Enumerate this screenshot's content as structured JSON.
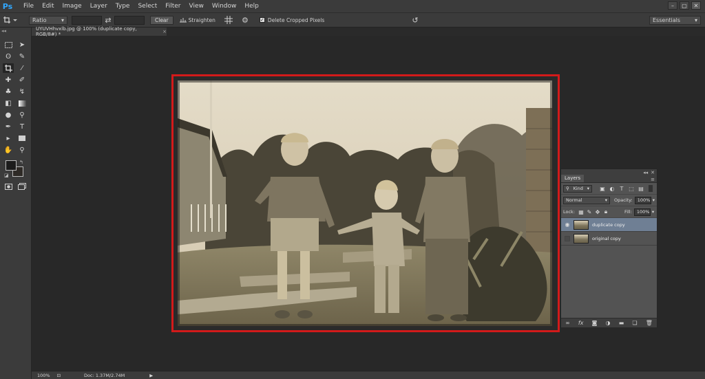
{
  "app": {
    "logo": "Ps"
  },
  "menu": [
    "File",
    "Edit",
    "Image",
    "Layer",
    "Type",
    "Select",
    "Filter",
    "View",
    "Window",
    "Help"
  ],
  "window_controls": {
    "minimize": "–",
    "maximize": "▢",
    "close": "✕"
  },
  "options": {
    "ratio_select": "Ratio",
    "clear_label": "Clear",
    "straighten_label": "Straighten",
    "delete_cropped_label": "Delete Cropped Pixels",
    "delete_cropped_checked": true,
    "workspace_select": "Essentials"
  },
  "document": {
    "tab_title": "UYUVHhvxlb.jpg @ 100% (duplicate copy, RGB/8#) *",
    "tab_close": "×"
  },
  "layers": {
    "panel_title": "Layers",
    "kind_label": "Kind",
    "blend_mode": "Normal",
    "opacity_label": "Opacity:",
    "opacity_value": "100%",
    "lock_label": "Lock:",
    "fill_label": "Fill:",
    "fill_value": "100%",
    "items": [
      {
        "name": "duplicate copy",
        "visible": true,
        "selected": true
      },
      {
        "name": "original copy",
        "visible": false,
        "selected": false
      }
    ],
    "footer_icons": [
      "link-icon",
      "fx-icon",
      "mask-icon",
      "adjustment-icon",
      "folder-icon",
      "new-layer-icon",
      "trash-icon"
    ]
  },
  "status": {
    "zoom": "100%",
    "doc_info": "Doc: 1.37M/2.74M"
  },
  "colors": {
    "selection_border": "#d31a1a",
    "selected_layer": "#6f7f94",
    "ps_blue": "#31a8ff"
  }
}
